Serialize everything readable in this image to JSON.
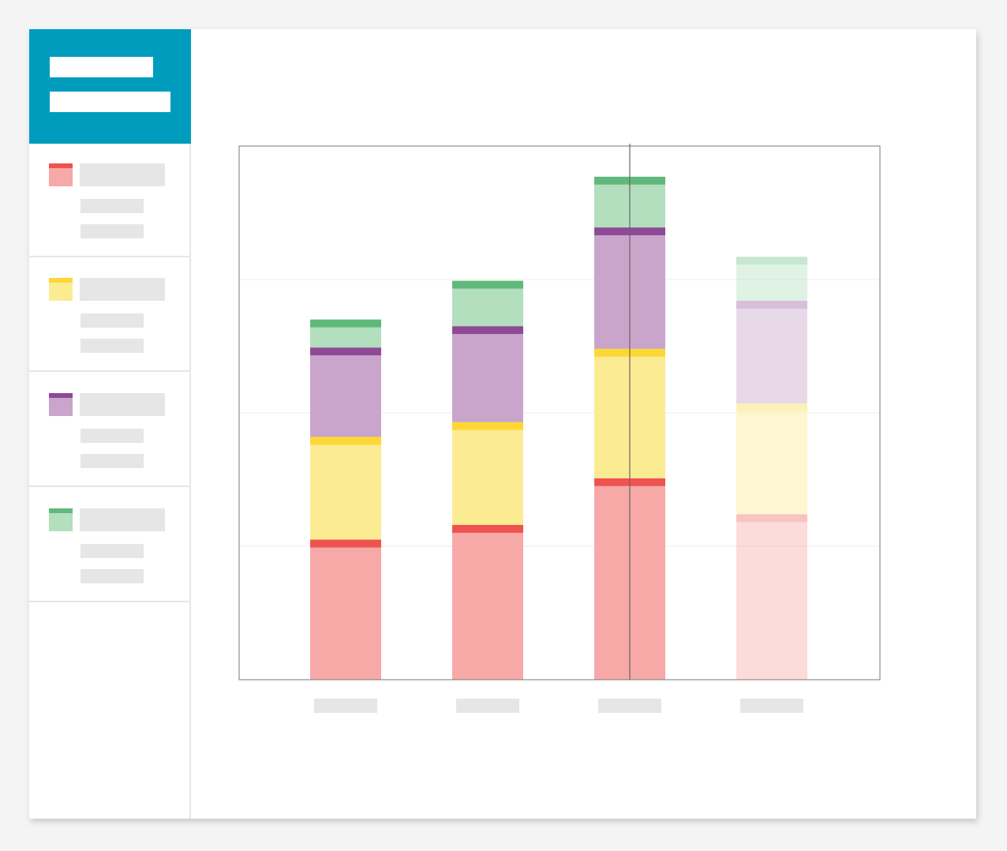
{
  "colors": {
    "accent": "#009cbd",
    "placeholder": "#e6e6e6",
    "series": [
      {
        "solid": "#ef5350",
        "fill": "#f7a9a8"
      },
      {
        "solid": "#fdd835",
        "fill": "#fbeb93"
      },
      {
        "solid": "#8e4a96",
        "fill": "#c9a5cb"
      },
      {
        "solid": "#5fb97a",
        "fill": "#b3dfbe"
      }
    ]
  },
  "sidebar": {
    "items": [
      {
        "series_index": 0
      },
      {
        "series_index": 1
      },
      {
        "series_index": 2
      },
      {
        "series_index": 3
      }
    ]
  },
  "chart_data": {
    "type": "bar",
    "stacked": true,
    "title": "",
    "xlabel": "",
    "ylabel": "",
    "categories": [
      "",
      "",
      "",
      ""
    ],
    "series": [
      {
        "values": [
          105,
          116,
          151,
          124
        ]
      },
      {
        "values": [
          77,
          77,
          97,
          83
        ]
      },
      {
        "values": [
          67,
          72,
          91,
          77
        ]
      },
      {
        "values": [
          21,
          34,
          38,
          33
        ]
      }
    ],
    "ylim": [
      0,
      400
    ],
    "grid": true,
    "faded_category_index": 3,
    "crosshair_category_index": 2
  }
}
